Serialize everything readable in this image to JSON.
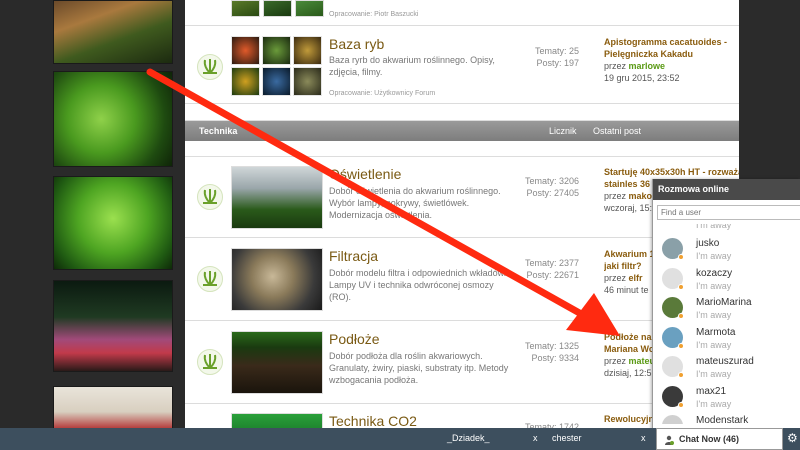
{
  "forums": {
    "top_partial": {
      "moderator": "Opracowanie: Piotr Baszucki"
    },
    "baza_ryb": {
      "title": "Baza ryb",
      "desc": "Baza ryrb do akwarium roślinnego. Opisy, zdjęcia, filmy.",
      "moderator": "Opracowanie: Użytkownicy Forum",
      "topics": "Tematy: 25",
      "posts": "Posty: 197",
      "last_title": "Apistogramma cacatuoides - Pielęgniczka Kakadu",
      "last_by_prefix": "przez",
      "last_user": "marlowe",
      "last_date": "19 gru 2015, 23:52"
    },
    "category": {
      "title": "Technika",
      "col_count": "Licznik",
      "col_last": "Ostatni post"
    },
    "oswietlenie": {
      "title": "Oświetlenie",
      "desc": "Dobór oświetlenia do akwarium roślinnego. Wybór lampy, pokrywy, świetlówek. Modernizacja oświetlenia.",
      "topics": "Tematy: 3206",
      "posts": "Posty: 27405",
      "last_title": "Startuję 40x35x30h HT - rozważam",
      "last_title2": "stainles 36",
      "last_by_prefix": "przez",
      "last_user": "makok",
      "last_date": "wczoraj, 15:"
    },
    "filtracja": {
      "title": "Filtracja",
      "desc": "Dobór modelu filtra i odpowiednich wkładów. Lampy UV i technika odwróconej osmozy (RO).",
      "topics": "Tematy: 2377",
      "posts": "Posty: 22671",
      "last_title": "Akwarium 1",
      "last_title2": "jaki filtr?",
      "last_by_prefix": "przez",
      "last_user": "elfr",
      "last_date": "46 minut te"
    },
    "podloze": {
      "title": "Podłoże",
      "desc": "Dobór podłoża dla roślin akwariowych. Granulaty, żwiry, piaski, substraty itp. Metody wzbogacania podłoża.",
      "topics": "Tematy: 1325",
      "posts": "Posty: 9334",
      "last_title": "Podłoże na",
      "last_title2": "Mariana Wo",
      "last_by_prefix": "przez",
      "last_user": "mateu",
      "last_date": "dzisiaj, 12:5"
    },
    "co2": {
      "title": "Technika CO2",
      "topics": "Tematy: 1742",
      "last_title": "Rewolucyjn"
    }
  },
  "chat": {
    "header": "Rozmowa online",
    "search_placeholder": "Find a user",
    "users": [
      {
        "name": "",
        "status": "I'm away"
      },
      {
        "name": "jusko",
        "status": "I'm away"
      },
      {
        "name": "kozaczy",
        "status": "I'm away"
      },
      {
        "name": "MarioMarina",
        "status": "I'm away"
      },
      {
        "name": "Marmota",
        "status": "I'm away"
      },
      {
        "name": "mateuszurad",
        "status": "I'm away"
      },
      {
        "name": "max21",
        "status": "I'm away"
      },
      {
        "name": "Modenstark",
        "status": ""
      }
    ],
    "chat_now": "Chat Now (46)"
  },
  "bottom_bar": {
    "tab1": "_Dziadek_",
    "tab2": "chester",
    "close": "x"
  },
  "colors": {
    "accent_arrow": "#ff2a10",
    "forum_title": "#7a5a14",
    "user_green": "#5a9a14",
    "category_bar": "#8a8a8a",
    "bottom_bar": "#3d4f5e"
  }
}
